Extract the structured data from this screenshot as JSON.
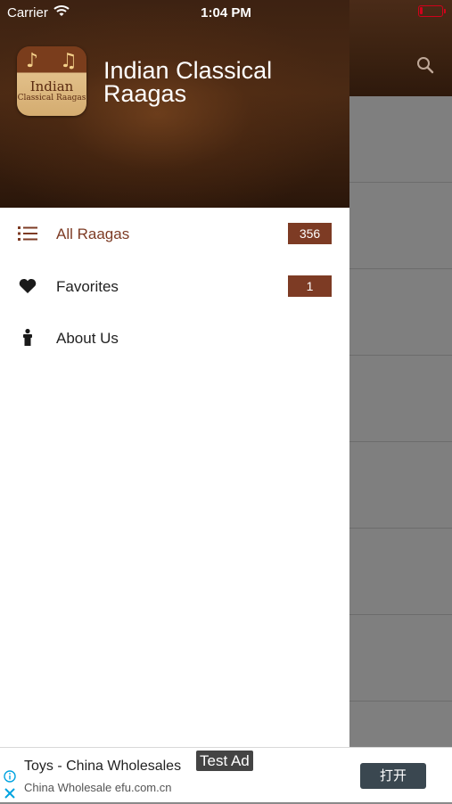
{
  "status_bar": {
    "carrier": "Carrier",
    "time": "1:04 PM"
  },
  "drawer": {
    "app_title": "Indian Classical Raagas",
    "logo": {
      "line1": "Indian",
      "line2": "Classical Raagas",
      "note_glyph_1": "♪",
      "note_glyph_2": "♫"
    },
    "menu": [
      {
        "label": "All Raagas",
        "count": "356",
        "icon": "list-icon",
        "active": true
      },
      {
        "label": "Favorites",
        "count": "1",
        "icon": "heart-icon",
        "active": false
      },
      {
        "label": "About Us",
        "icon": "person-icon",
        "active": false
      }
    ]
  },
  "background": {
    "search_icon": "search-icon"
  },
  "ad": {
    "title": "Toys - China Wholesales",
    "subtitle": "China Wholesale efu.com.cn",
    "tag": "Test Ad",
    "cta": "打开"
  },
  "colors": {
    "accent": "#7d3b24",
    "header_brown": "#3d2212",
    "battery_low": "#d0021b",
    "ad_button": "#3a4750"
  }
}
